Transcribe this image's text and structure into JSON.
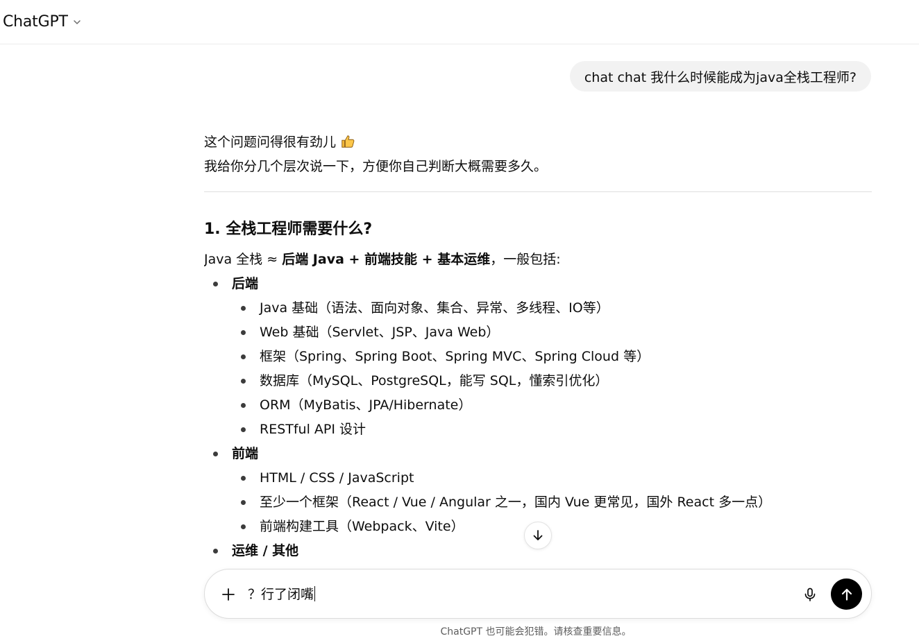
{
  "header": {
    "model_name": "ChatGPT"
  },
  "conversation": {
    "user_message": "chat chat 我什么时候能成为java全栈工程师?",
    "assistant": {
      "opening_line_1": "这个问题问得很有劲儿",
      "opening_line_1_emoji": "thumbs-up-icon",
      "opening_line_2": "我给你分几个层次说一下，方便你自己判断大概需要多久。",
      "section_1_title": "1. 全栈工程师需要什么?",
      "intro": {
        "prefix": "Java 全栈 ≈ ",
        "bold": "后端 Java + 前端技能 + 基本运维",
        "suffix": "，一般包括:"
      },
      "groups": [
        {
          "title": "后端",
          "items": [
            "Java 基础（语法、面向对象、集合、异常、多线程、IO等）",
            "Web 基础（Servlet、JSP、Java Web）",
            "框架（Spring、Spring Boot、Spring MVC、Spring Cloud 等）",
            "数据库（MySQL、PostgreSQL，能写 SQL，懂索引优化）",
            "ORM（MyBatis、JPA/Hibernate）",
            "RESTful API 设计"
          ]
        },
        {
          "title": "前端",
          "items": [
            "HTML / CSS / JavaScript",
            "至少一个框架（React / Vue / Angular 之一，国内 Vue 更常见，国外 React 多一点）",
            "前端构建工具（Webpack、Vite）"
          ]
        },
        {
          "title": "运维 / 其他",
          "items": []
        }
      ]
    }
  },
  "composer": {
    "input_value": "？行了闭嘴",
    "plus_icon": "plus-icon",
    "mic_icon": "microphone-icon",
    "send_icon": "arrow-up-icon"
  },
  "scroll_button_icon": "arrow-down-icon",
  "footer": {
    "disclaimer": "ChatGPT 也可能会犯错。请核查重要信息。"
  }
}
